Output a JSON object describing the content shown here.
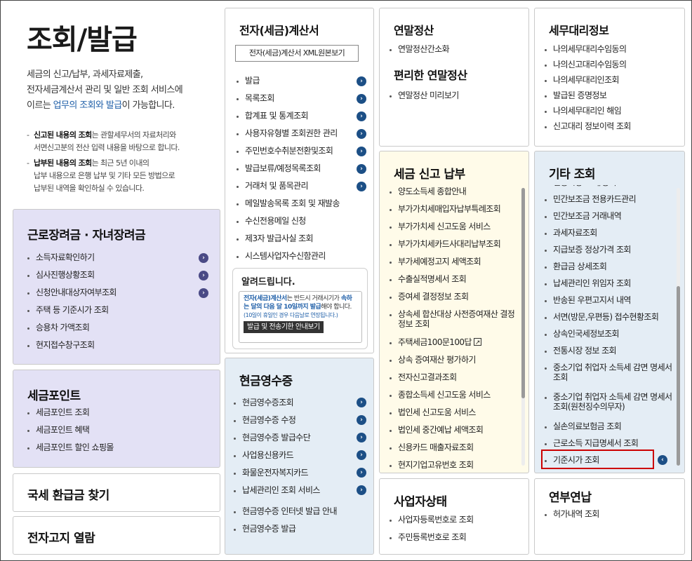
{
  "main": {
    "title": "조회/발급",
    "intro_1": "세금의 신고/납부, 과세자료제출,",
    "intro_2": "전자세금계산서 관리 및 일반 조회 서비스에",
    "intro_3a": "이르는 ",
    "intro_3b": "업무의 조회와 발급",
    "intro_3c": "이 가능합니다.",
    "note1_bold": "신고된 내용의 조회",
    "note1_rest": "는 관할세무서의 자료처리와",
    "note1_line2": "서면신고분의 전산 입력 내용을 바탕으로 합니다.",
    "note2_bold": "납부된 내용의 조회",
    "note2_rest": "는 최근 5년 이내의",
    "note2_line2": "납부 내용으로 은행 납부 및 기타 모든 방법으로",
    "note2_line3": "납부된 내역을 확인하실 수 있습니다."
  },
  "worker": {
    "title": "근로장려금 · 자녀장려금",
    "items": [
      "소득자료확인하기",
      "심사진행상황조회",
      "신청안내대상자여부조회",
      "주택 등 기준시가 조회",
      "승용차 가액조회",
      "현지접수창구조회"
    ]
  },
  "taxpoint": {
    "title": "세금포인트",
    "items": [
      "세금포인트 조회",
      "세금포인트 혜택",
      "세금포인트 할인 쇼핑몰"
    ]
  },
  "refund": {
    "title": "국세 환급금 찾기"
  },
  "enotice": {
    "title": "전자고지 열람"
  },
  "einvoice": {
    "title": "전자(세금)계산서",
    "xml_button": "전자(세금)계산서 XML원본보기",
    "items": [
      "발급",
      "목록조회",
      "합계표 및 통계조회",
      "사용자유형별 조회권한 관리",
      "주민번호수취분전환및조회",
      "발급보류/예정목록조회",
      "거래처 및 품목관리",
      "메일발송목록 조회 및 재발송",
      "수신전용메일 신청",
      "제3자 발급사실 조회",
      "시스템사업자수신함관리"
    ]
  },
  "notice": {
    "title": "알려드립니다.",
    "t1": "전자(세금)계산서",
    "t2": "는 반드시 거래시기가",
    "t3": "속하는 달의 다음 달 10일까지 발급",
    "t4": "해야 합니다.",
    "t5": "(10일이 휴일인 경우 다음날로 연장됩니다.)",
    "button": "발급 및 전송기한 안내보기"
  },
  "cash": {
    "title": "현금영수증",
    "items": [
      "현금영수증조회",
      "현금영수증 수정",
      "현금영수증 발급수단",
      "사업용신용카드",
      "화물운전자복지카드",
      "납세관리인 조회 서비스",
      "현금영수증 인터넷 발급 안내",
      "현금영수증 발급"
    ]
  },
  "yearend": {
    "title": "연말정산",
    "item": "연말정산간소화",
    "subtitle": "편리한 연말정산",
    "item2": "연말정산 미리보기"
  },
  "taxfile": {
    "title": "세금 신고 납부",
    "items": [
      "양도소득세 종합안내",
      "부가가치세매입자납부특례조회",
      "부가가치세 신고도움 서비스",
      "부가가치세카드사대리납부조회",
      "부가세예정고지 세액조회",
      "수출실적명세서 조회",
      "증여세 결정정보 조회",
      "상속세 합산대상 사전증여재산 결정정보 조회",
      "주택세금100문100답",
      "상속 증여재산 평가하기",
      "전자신고결과조회",
      "종합소득세 신고도움 서비스",
      "법인세 신고도움 서비스",
      "법인세 중간예납 세액조회",
      "신용카드 매출자료조회",
      "현지기업고유번호 조회"
    ]
  },
  "business": {
    "title": "사업자상태",
    "items": [
      "사업자등록번호로 조회",
      "주민등록번호로 조회"
    ]
  },
  "agent": {
    "title": "세무대리정보",
    "items": [
      "나의세무대리수임동의",
      "나의신고대리수임동의",
      "나의세무대리인조회",
      "발급된 증명정보",
      "나의세무대리인 해임",
      "신고대리 정보이력 조회"
    ]
  },
  "other": {
    "title": "기타 조회",
    "items": [
      "전통시장 조회/등록",
      "민간보조금 전용카드관리",
      "민간보조금 거래내역",
      "과세자료조회",
      "지급보증 정상가격 조회",
      "환급금 상세조회",
      "납세관리인 위임자 조회",
      "반송된 우편고지서 내역",
      "서면(방문,우편등) 접수현황조회",
      "상속인국세정보조회",
      "전통시장 정보 조회",
      "중소기업 취업자 소득세 감면 명세서 조회",
      "중소기업 취업자 소득세 감면 명세서 조회(원천징수의무자)",
      "실손의료보험금 조회",
      "근로소득 지급명세서 조회",
      "기준시가 조회"
    ]
  },
  "pension": {
    "title": "연부연납",
    "items": [
      "허가내역 조회"
    ]
  }
}
